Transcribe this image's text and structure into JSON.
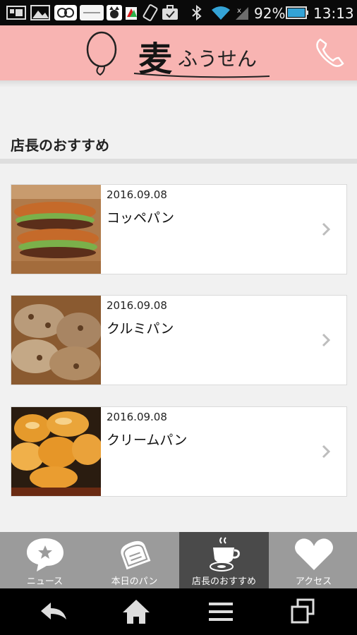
{
  "status": {
    "battery_percent": "92%",
    "time": "13:13",
    "icons": [
      "screenshot-icon",
      "gallery-icon",
      "app-icon",
      "harvest-app-icon",
      "cat-app-icon",
      "signal-app-icon",
      "rotate-icon",
      "briefcase-icon",
      "bluetooth-icon",
      "wifi-icon",
      "cell-signal-icon",
      "battery-icon"
    ]
  },
  "header": {
    "logo_kanji": "麦",
    "logo_kana": "ふうせん",
    "call_icon": "phone-icon",
    "colors": {
      "background": "#f8b4b2"
    }
  },
  "section": {
    "title": "店長のおすすめ"
  },
  "items": [
    {
      "date": "2016.09.08",
      "title": "コッペパン",
      "image": "sandwich-bread"
    },
    {
      "date": "2016.09.08",
      "title": "クルミパン",
      "image": "walnut-bread"
    },
    {
      "date": "2016.09.08",
      "title": "クリームパン",
      "image": "cream-bun"
    }
  ],
  "tabs": [
    {
      "label": "ニュース",
      "icon": "news-star-icon",
      "active": false
    },
    {
      "label": "本日のパン",
      "icon": "bread-icon",
      "active": false
    },
    {
      "label": "店長のおすすめ",
      "icon": "coffee-icon",
      "active": true
    },
    {
      "label": "アクセス",
      "icon": "heart-icon",
      "active": false
    }
  ],
  "nav": {
    "icons": [
      "back-icon",
      "home-icon",
      "menu-icon",
      "recent-apps-icon"
    ]
  }
}
